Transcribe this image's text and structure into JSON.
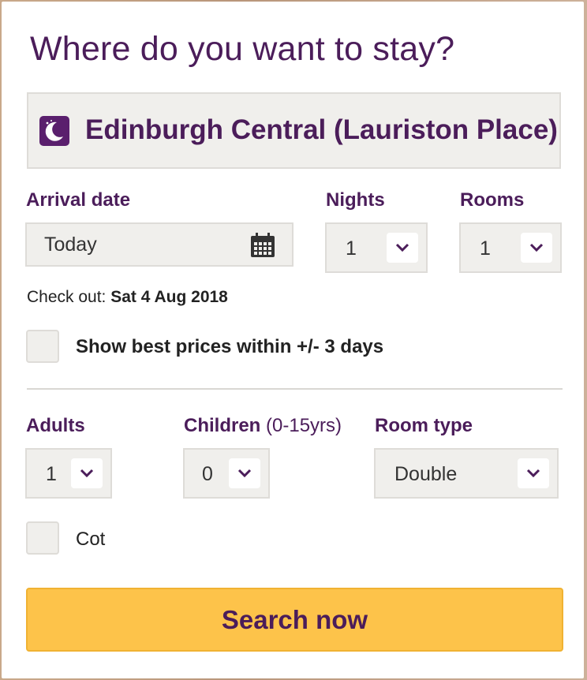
{
  "heading": "Where do you want to stay?",
  "destination": {
    "value": "Edinburgh Central (Lauriston Place)",
    "icon": "moon-icon"
  },
  "arrival": {
    "label": "Arrival date",
    "value": "Today",
    "icon": "calendar-icon"
  },
  "nights": {
    "label": "Nights",
    "value": "1"
  },
  "rooms": {
    "label": "Rooms",
    "value": "1"
  },
  "checkout": {
    "prefix": "Check out:",
    "date": "Sat 4 Aug 2018"
  },
  "flexible_dates": {
    "label": "Show best prices within +/- 3 days",
    "checked": false
  },
  "adults": {
    "label": "Adults",
    "value": "1"
  },
  "children": {
    "label": "Children",
    "range": "(0-15yrs)",
    "value": "0"
  },
  "room_type": {
    "label": "Room type",
    "value": "Double"
  },
  "cot": {
    "label": "Cot",
    "checked": false
  },
  "search_button": "Search now",
  "colors": {
    "brand": "#4b1d5a",
    "accent": "#fdc34a",
    "field_bg": "#f0efec"
  }
}
